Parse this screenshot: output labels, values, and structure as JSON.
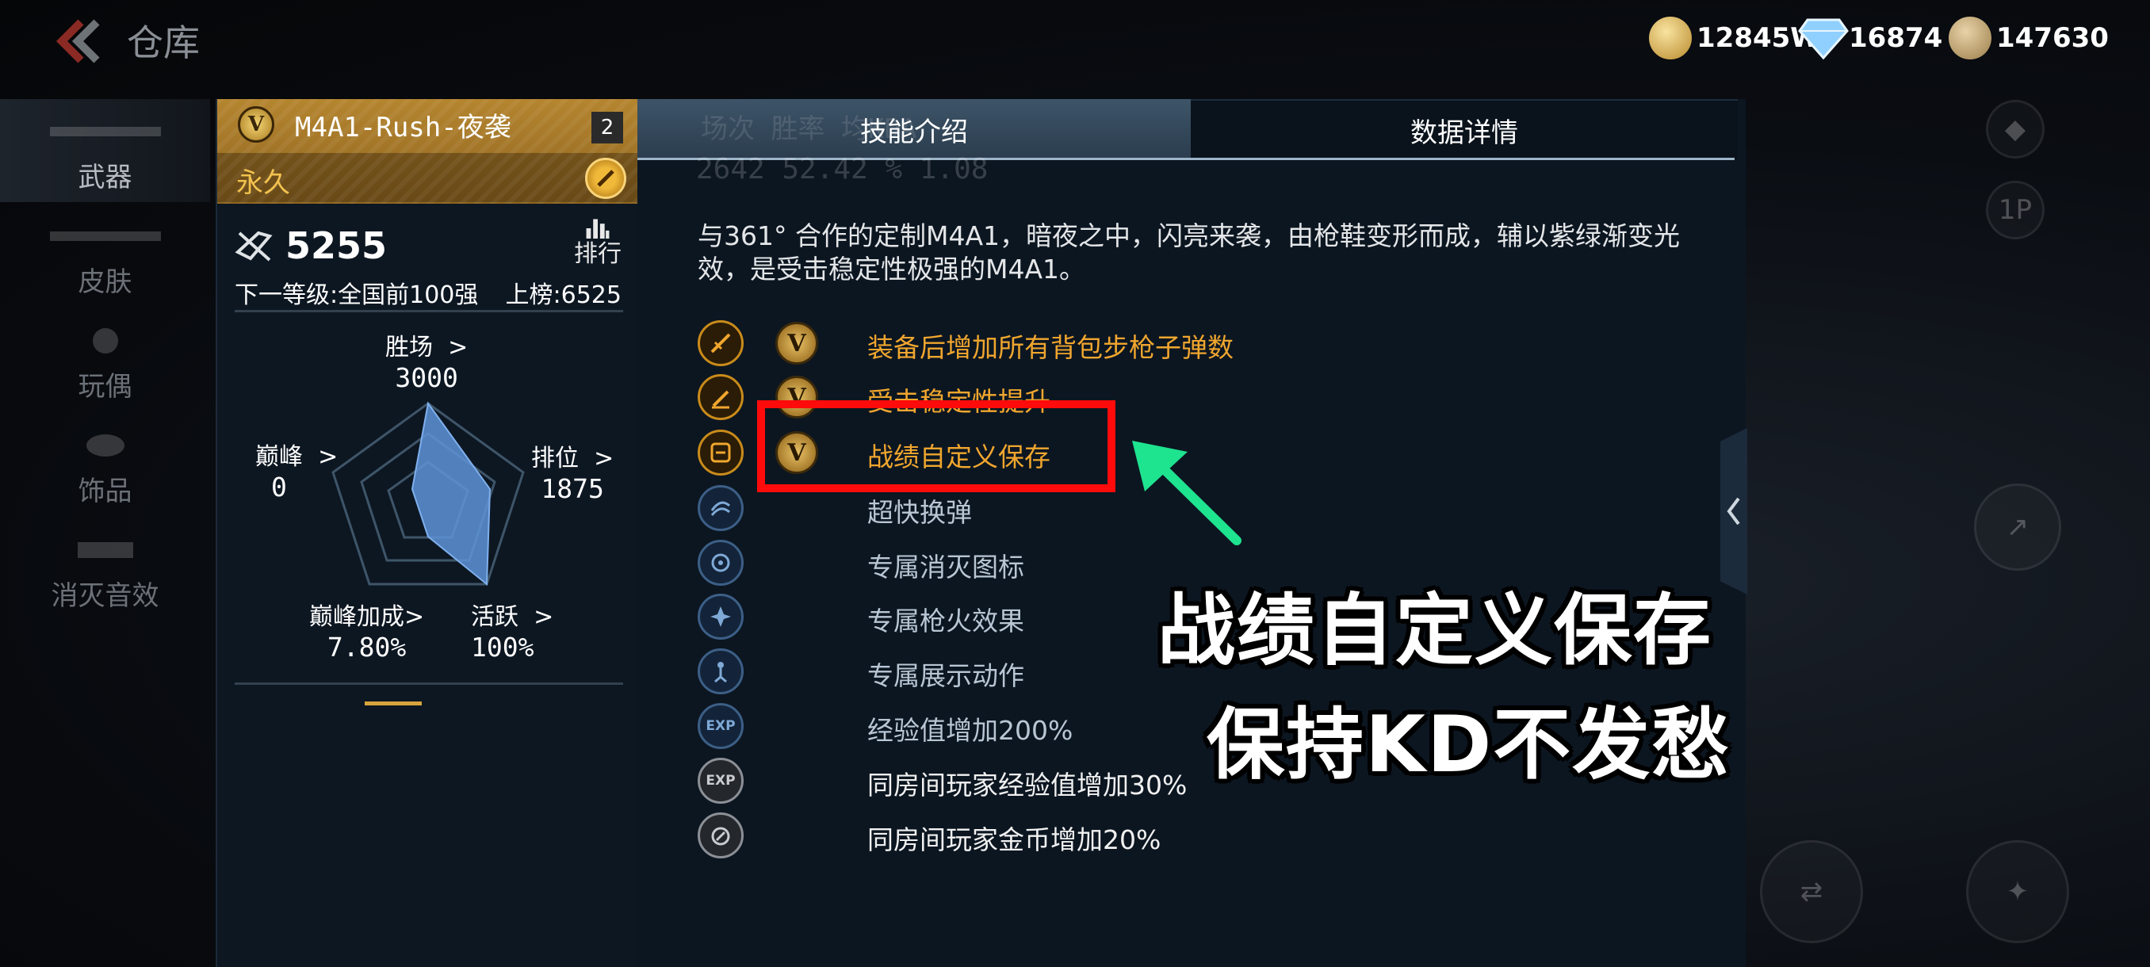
{
  "header": {
    "title": "仓库",
    "currencies": [
      {
        "name": "gold-coin",
        "value": "12845W"
      },
      {
        "name": "diamond",
        "value": "16874"
      },
      {
        "name": "token",
        "value": "147630"
      }
    ]
  },
  "nav": {
    "items": [
      "武器",
      "皮肤",
      "玩偶",
      "饰品",
      "消灭音效"
    ]
  },
  "card": {
    "weapon_name": "M4A1-Rush-夜袭",
    "level_badge": "2",
    "v_letter": "V",
    "duration": "永久",
    "kills": "5255",
    "rank_label": "排行",
    "next_level": "下一等级:全国前100强",
    "board": "上榜:6525",
    "stats": {
      "wins": {
        "label": "胜场",
        "value": "3000"
      },
      "ranked": {
        "label": "排位",
        "value": "1875"
      },
      "active": {
        "label": "活跃",
        "value": "100%"
      },
      "peak_bonus": {
        "label": "巅峰加成",
        "value": "7.80%"
      },
      "peak": {
        "label": "巅峰",
        "value": "0"
      }
    }
  },
  "panel": {
    "tabs": {
      "skill": "技能介绍",
      "data": "数据详情"
    },
    "faded_headers": "场次        胜率         均KDA",
    "faded_values": "2642        52.42 %       1.08",
    "description": "与361° 合作的定制M4A1，暗夜之中，闪亮来袭，由枪鞋变形而成，辅以紫绿渐变光效，是受击稳定性极强的M4A1。",
    "skills": [
      "装备后增加所有背包步枪子弹数",
      "受击稳定性提升",
      "战绩自定义保存",
      "超快换弹",
      "专属消灭图标",
      "专属枪火效果",
      "专属展示动作",
      "经验值增加200%",
      "同房间玩家经验值增加30%",
      "同房间玩家金币增加20%"
    ],
    "exp_icon_text": "EXP"
  },
  "overlay": {
    "caption_line1": "战绩自定义保存",
    "caption_line2": "保持KD不发愁",
    "highlight_color": "#ff0b0b",
    "arrow_color": "#1ee38f"
  },
  "right_controls": {
    "view_label": "1P"
  }
}
